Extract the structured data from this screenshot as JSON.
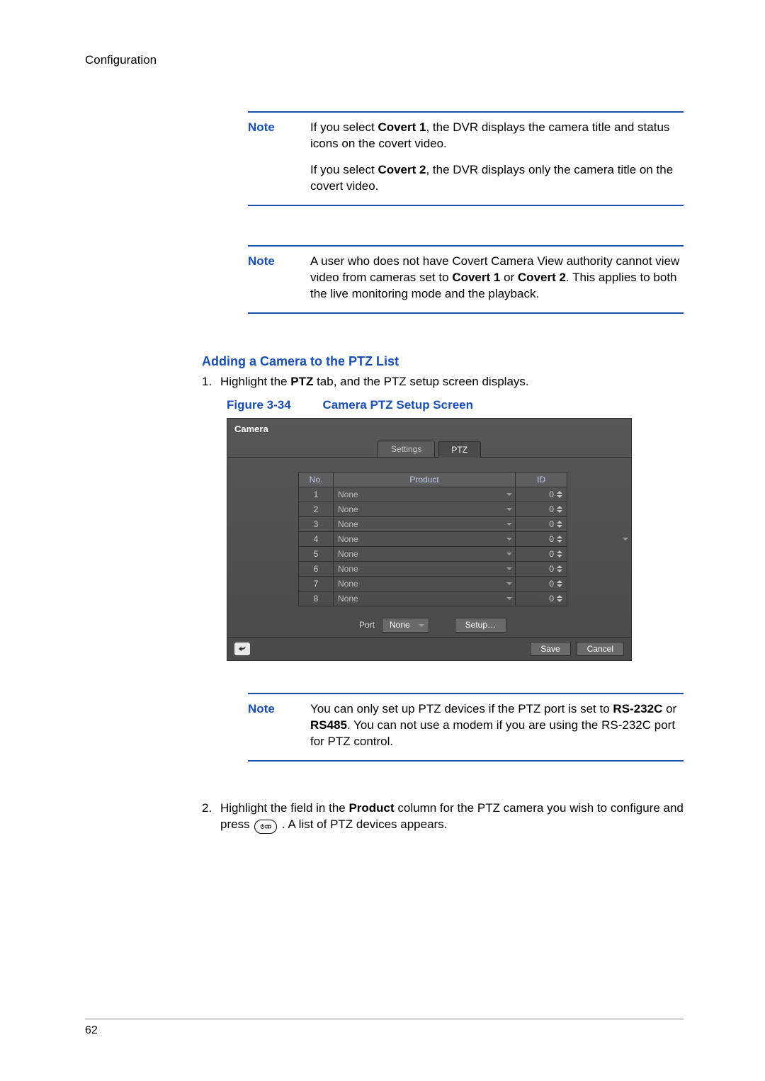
{
  "header": {
    "running": "Configuration"
  },
  "notes": {
    "label": "Note",
    "note1_p1_a": "If you select ",
    "note1_p1_b": "Covert 1",
    "note1_p1_c": ", the DVR displays the camera title and status icons on the covert video.",
    "note1_p2_a": "If you select ",
    "note1_p2_b": "Covert 2",
    "note1_p2_c": ", the DVR displays only the camera title on the covert video.",
    "note2_a": "A user who does not have Covert Camera View authority cannot view video from cameras set to ",
    "note2_b": "Covert 1",
    "note2_c": " or ",
    "note2_d": "Covert 2",
    "note2_e": ". This applies to both the live monitoring mode and the playback.",
    "note3_a": "You can only set up PTZ devices if the PTZ port is set to ",
    "note3_b": "RS-232C",
    "note3_c": " or ",
    "note3_d": "RS485",
    "note3_e": ". You can not use a modem if you are using the RS-232C port for PTZ control."
  },
  "section": {
    "title": "Adding a Camera to the PTZ List"
  },
  "steps": {
    "s1_num": "1.",
    "s1_a": "Highlight the ",
    "s1_b": "PTZ",
    "s1_c": " tab, and the PTZ setup screen displays.",
    "s2_num": "2.",
    "s2_a": "Highlight the field in the ",
    "s2_b": "Product",
    "s2_c": " column for the PTZ camera you wish to configure and press ",
    "s2_d": ". A list of PTZ devices appears."
  },
  "figure": {
    "label": "Figure 3-34",
    "title": "Camera PTZ Setup Screen"
  },
  "dvr": {
    "title": "Camera",
    "tabs": {
      "settings": "Settings",
      "ptz": "PTZ"
    },
    "headers": {
      "no": "No.",
      "product": "Product",
      "id": "ID"
    },
    "rows": [
      {
        "no": "1",
        "product": "None",
        "id": "0"
      },
      {
        "no": "2",
        "product": "None",
        "id": "0"
      },
      {
        "no": "3",
        "product": "None",
        "id": "0"
      },
      {
        "no": "4",
        "product": "None",
        "id": "0"
      },
      {
        "no": "5",
        "product": "None",
        "id": "0"
      },
      {
        "no": "6",
        "product": "None",
        "id": "0"
      },
      {
        "no": "7",
        "product": "None",
        "id": "0"
      },
      {
        "no": "8",
        "product": "None",
        "id": "0"
      }
    ],
    "port_label": "Port",
    "port_value": "None",
    "setup_btn": "Setup…",
    "save_btn": "Save",
    "cancel_btn": "Cancel"
  },
  "footer": {
    "page": "62"
  }
}
